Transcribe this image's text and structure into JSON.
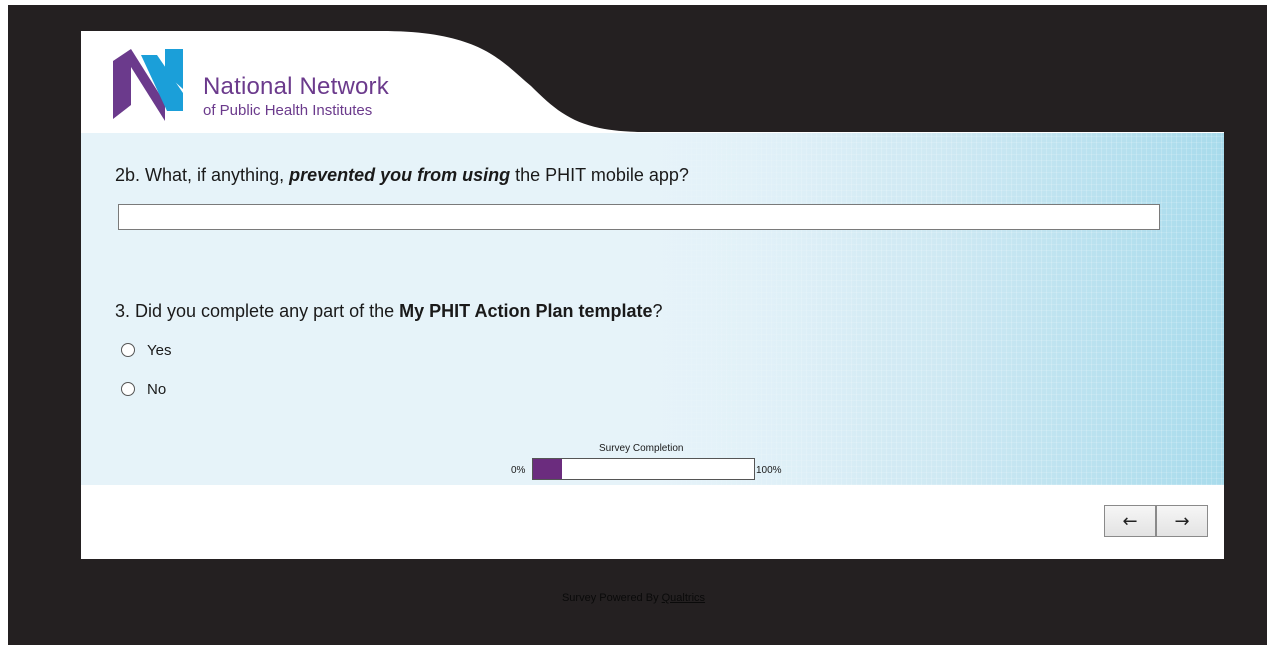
{
  "brand": {
    "name_line1": "National Network",
    "name_line2": "of Public Health Institutes",
    "colors": {
      "purple": "#6b3a8c",
      "blue": "#1b9fd9"
    }
  },
  "question_2b": {
    "prefix": "2b. What, if anything, ",
    "emphasis": "prevented you from using",
    "suffix": " the PHIT mobile app?",
    "answer_value": ""
  },
  "question_3": {
    "prefix": "3.  Did you complete any part of the ",
    "emphasis": "My PHIT Action Plan template",
    "suffix": "?",
    "options": [
      "Yes",
      "No"
    ],
    "selected": null
  },
  "progress": {
    "title": "Survey Completion",
    "min_label": "0%",
    "max_label": "100%",
    "fraction": 0.13,
    "fill_color": "#6b2c7e"
  },
  "navigation": {
    "back_label": "←",
    "next_label": "→"
  },
  "footer": {
    "text": "Survey Powered By ",
    "link": "Qualtrics"
  }
}
